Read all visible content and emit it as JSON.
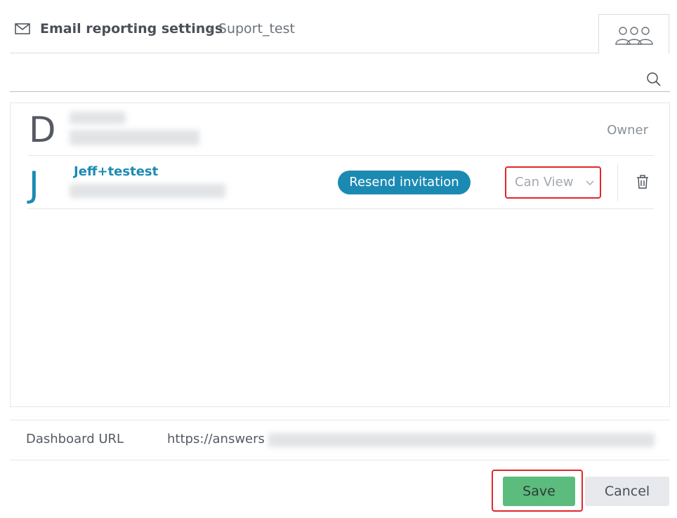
{
  "header": {
    "title": "Email reporting settings",
    "subtitle": "- Suport_test",
    "mail_icon": "envelope-icon",
    "users_tab_icon": "users-group-icon"
  },
  "search": {
    "placeholder": "",
    "value": "",
    "icon": "search-icon"
  },
  "users": [
    {
      "avatar_letter": "D",
      "role": "Owner"
    },
    {
      "avatar_letter": "J",
      "name": "Jeff+testest",
      "resend_label": "Resend invitation",
      "permission": "Can View",
      "delete_icon": "trash-icon"
    }
  ],
  "dashboard_url": {
    "label": "Dashboard URL",
    "value": "https://answers"
  },
  "buttons": {
    "save": "Save",
    "cancel": "Cancel"
  },
  "colors": {
    "accent": "#1b8ab3",
    "save": "#5bbc7d",
    "highlight": "#e0262c"
  }
}
